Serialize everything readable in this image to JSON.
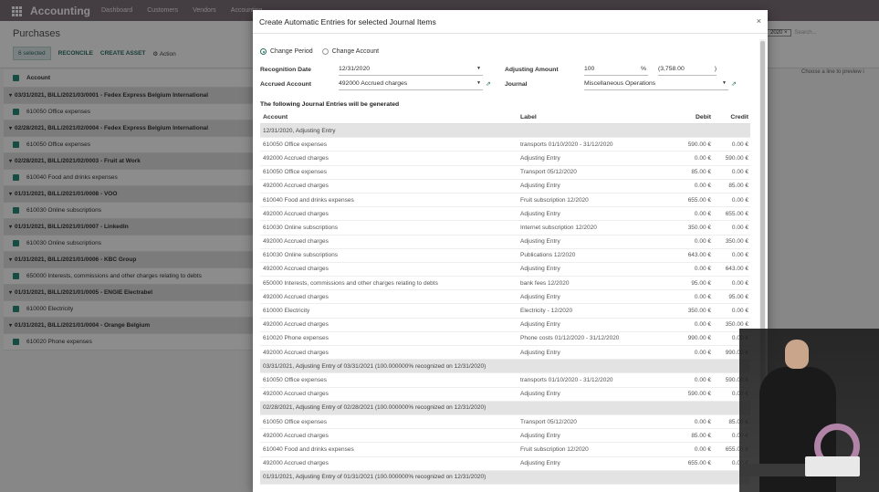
{
  "navbar": {
    "title": "Accounting",
    "items": [
      "Dashboard",
      "Customers",
      "Vendors",
      "Accounting"
    ]
  },
  "page": {
    "title": "Purchases",
    "selected_label": "6 selected",
    "reconcile_label": "RECONCILE",
    "create_asset_label": "CREATE ASSET",
    "action_label": "Action",
    "date_chip": "2020",
    "search_placeholder": "Search...",
    "right_pane_text": "Choose a line to preview i",
    "list_header": "Account",
    "rows": [
      {
        "type": "group",
        "text": "03/31/2021, BILL/2021/03/0001 - Fedex Express Belgium International"
      },
      {
        "type": "item",
        "text": "610050 Office expenses"
      },
      {
        "type": "group",
        "text": "02/28/2021, BILL/2021/02/0004 - Fedex Express Belgium International"
      },
      {
        "type": "item",
        "text": "610050 Office expenses"
      },
      {
        "type": "group",
        "text": "02/28/2021, BILL/2021/02/0003 - Fruit at Work"
      },
      {
        "type": "item",
        "text": "610040 Food and drinks expenses"
      },
      {
        "type": "group",
        "text": "01/31/2021, BILL/2021/01/0008 - VOO"
      },
      {
        "type": "item",
        "text": "610030 Online subscriptions"
      },
      {
        "type": "group",
        "text": "01/31/2021, BILL/2021/01/0007 - LinkedIn"
      },
      {
        "type": "item",
        "text": "610030 Online subscriptions"
      },
      {
        "type": "group",
        "text": "01/31/2021, BILL/2021/01/0006 - KBC Group"
      },
      {
        "type": "item",
        "text": "650000 Interests, commissions and other charges relating to debts"
      },
      {
        "type": "group",
        "text": "01/31/2021, BILL/2021/01/0005 - ENGIE Electrabel"
      },
      {
        "type": "item",
        "text": "610000 Electricity"
      },
      {
        "type": "group",
        "text": "01/31/2021, BILL/2021/01/0004 - Orange Belgium"
      },
      {
        "type": "item",
        "text": "610020 Phone expenses"
      }
    ]
  },
  "modal": {
    "title": "Create Automatic Entries for selected Journal Items",
    "close": "×",
    "radio_change_period": "Change Period",
    "radio_change_account": "Change Account",
    "recognition_date_label": "Recognition Date",
    "recognition_date_value": "12/31/2020",
    "accrued_account_label": "Accrued Account",
    "accrued_account_value": "492000 Accrued charges",
    "adjusting_amount_label": "Adjusting Amount",
    "adjusting_amount_value": "100",
    "percent_sign": "%",
    "adjusting_amount_total": "(3,758.00",
    "adjusting_amount_close": ")",
    "journal_label": "Journal",
    "journal_value": "Miscellaneous Operations",
    "generated_title": "The following Journal Entries will be generated",
    "columns": {
      "account": "Account",
      "label": "Label",
      "debit": "Debit",
      "credit": "Credit"
    },
    "entries": [
      {
        "group": "12/31/2020, Adjusting Entry"
      },
      {
        "account": "610050 Office expenses",
        "label": "transports 01/10/2020 - 31/12/2020",
        "debit": "590.00 €",
        "credit": "0.00 €"
      },
      {
        "account": "492000 Accrued charges",
        "label": "Adjusting Entry",
        "debit": "0.00 €",
        "credit": "590.00 €"
      },
      {
        "account": "610050 Office expenses",
        "label": "Transport 05/12/2020",
        "debit": "85.00 €",
        "credit": "0.00 €"
      },
      {
        "account": "492000 Accrued charges",
        "label": "Adjusting Entry",
        "debit": "0.00 €",
        "credit": "85.00 €"
      },
      {
        "account": "610040 Food and drinks expenses",
        "label": "Fruit subscription 12/2020",
        "debit": "655.00 €",
        "credit": "0.00 €"
      },
      {
        "account": "492000 Accrued charges",
        "label": "Adjusting Entry",
        "debit": "0.00 €",
        "credit": "655.00 €"
      },
      {
        "account": "610030 Online subscriptions",
        "label": "Internet subscription 12/2020",
        "debit": "350.00 €",
        "credit": "0.00 €"
      },
      {
        "account": "492000 Accrued charges",
        "label": "Adjusting Entry",
        "debit": "0.00 €",
        "credit": "350.00 €"
      },
      {
        "account": "610030 Online subscriptions",
        "label": "Publications 12/2020",
        "debit": "643.00 €",
        "credit": "0.00 €"
      },
      {
        "account": "492000 Accrued charges",
        "label": "Adjusting Entry",
        "debit": "0.00 €",
        "credit": "643.00 €"
      },
      {
        "account": "650000 Interests, commissions and other charges relating to debts",
        "label": "bank fees 12/2020",
        "debit": "95.00 €",
        "credit": "0.00 €"
      },
      {
        "account": "492000 Accrued charges",
        "label": "Adjusting Entry",
        "debit": "0.00 €",
        "credit": "95.00 €"
      },
      {
        "account": "610000 Electricity",
        "label": "Electricity - 12/2020",
        "debit": "350.00 €",
        "credit": "0.00 €"
      },
      {
        "account": "492000 Accrued charges",
        "label": "Adjusting Entry",
        "debit": "0.00 €",
        "credit": "350.00 €"
      },
      {
        "account": "610020 Phone expenses",
        "label": "Phone costs 01/12/2020 - 31/12/2020",
        "debit": "990.00 €",
        "credit": "0.00 €"
      },
      {
        "account": "492000 Accrued charges",
        "label": "Adjusting Entry",
        "debit": "0.00 €",
        "credit": "990.00 €"
      },
      {
        "group": "03/31/2021, Adjusting Entry of 03/31/2021 (100.000000% recognized on 12/31/2020)"
      },
      {
        "account": "610050 Office expenses",
        "label": "transports 01/10/2020 - 31/12/2020",
        "debit": "0.00 €",
        "credit": "590.00 €"
      },
      {
        "account": "492000 Accrued charges",
        "label": "Adjusting Entry",
        "debit": "590.00 €",
        "credit": "0.00 €"
      },
      {
        "group": "02/28/2021, Adjusting Entry of 02/28/2021 (100.000000% recognized on 12/31/2020)"
      },
      {
        "account": "610050 Office expenses",
        "label": "Transport 05/12/2020",
        "debit": "0.00 €",
        "credit": "85.00 €"
      },
      {
        "account": "492000 Accrued charges",
        "label": "Adjusting Entry",
        "debit": "85.00 €",
        "credit": "0.00 €"
      },
      {
        "account": "610040 Food and drinks expenses",
        "label": "Fruit subscription 12/2020",
        "debit": "0.00 €",
        "credit": "655.00 €"
      },
      {
        "account": "492000 Accrued charges",
        "label": "Adjusting Entry",
        "debit": "655.00 €",
        "credit": "0.00 €"
      },
      {
        "group": "01/31/2021, Adjusting Entry of 01/31/2021 (100.000000% recognized on 12/31/2020)"
      }
    ]
  },
  "colors": {
    "navbar": "#7c6f79",
    "accent": "#2b6e62"
  }
}
